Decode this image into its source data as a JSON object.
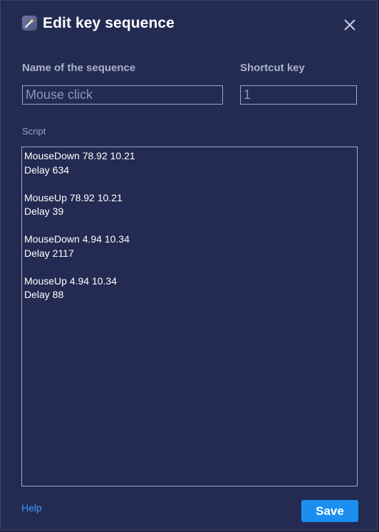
{
  "dialog": {
    "title": "Edit key sequence",
    "title_icon": "magic-wand-icon",
    "close_icon": "close-icon"
  },
  "form": {
    "name_label": "Name of the sequence",
    "name_value": "Mouse click",
    "shortcut_label": "Shortcut key",
    "shortcut_value": "1",
    "script_label": "Script",
    "script_lines": [
      "MouseDown 78.92 10.21",
      "Delay 634",
      "",
      "MouseUp 78.92 10.21",
      "Delay 39",
      "",
      "MouseDown 4.94 10.34",
      "Delay 2117",
      "",
      "MouseUp 4.94 10.34",
      "Delay 88"
    ]
  },
  "footer": {
    "help_label": "Help",
    "save_label": "Save"
  },
  "colors": {
    "background": "#242b52",
    "accent": "#1a8ff0",
    "link": "#3c9af5"
  }
}
